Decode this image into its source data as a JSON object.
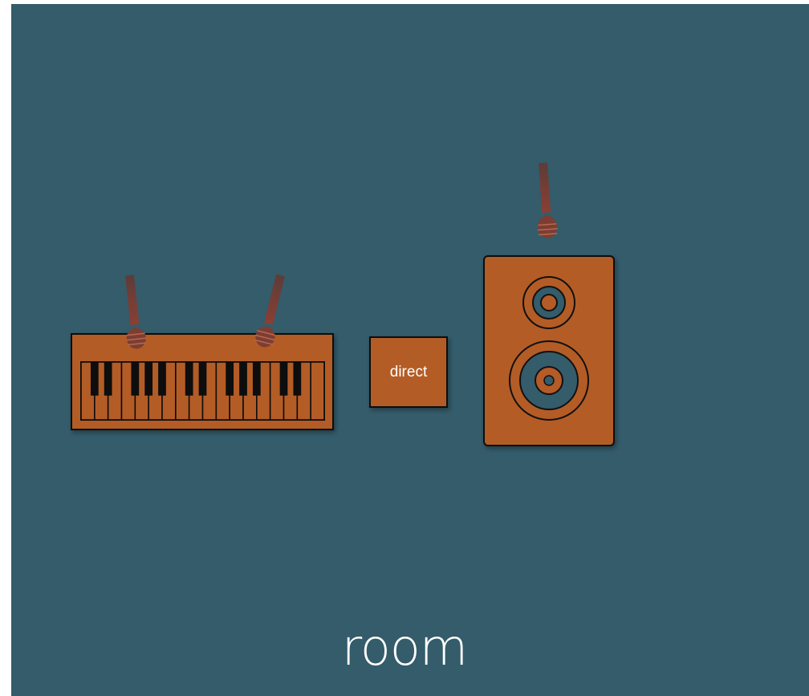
{
  "colors": {
    "background": "#345c6a",
    "instrument": "#b45b27",
    "outline": "#111111",
    "microphone": "#7d3d33",
    "label": "#ffffff"
  },
  "labels": {
    "direct": "direct",
    "room": "room"
  },
  "icons": [
    "keyboard-icon",
    "microphone-icon",
    "speaker-icon"
  ]
}
